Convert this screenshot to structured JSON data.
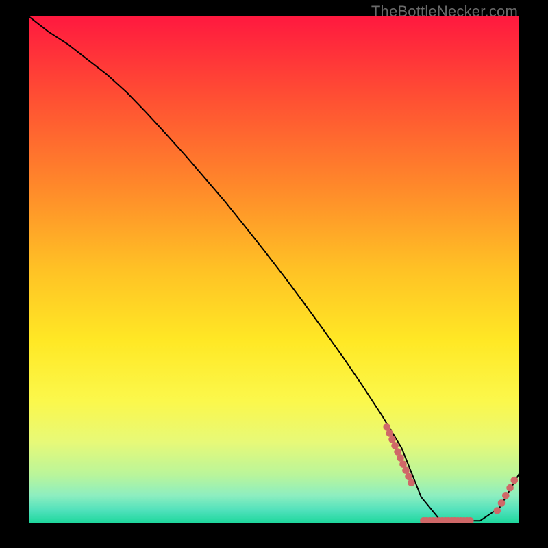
{
  "watermark": "TheBottleNecker.com",
  "chart_data": {
    "type": "line",
    "title": "",
    "xlabel": "",
    "ylabel": "",
    "xlim": [
      0,
      100
    ],
    "ylim": [
      0,
      100
    ],
    "series": [
      {
        "name": "curve",
        "x": [
          0,
          4,
          8,
          12,
          16,
          20,
          24,
          28,
          32,
          36,
          40,
          44,
          48,
          52,
          56,
          60,
          64,
          68,
          72,
          76,
          80,
          84,
          88,
          92,
          96,
          100
        ],
        "y": [
          100,
          97,
          94.5,
          91.5,
          88.5,
          85,
          81,
          76.8,
          72.5,
          68,
          63.5,
          58.7,
          53.8,
          48.8,
          43.6,
          38.3,
          32.9,
          27.2,
          21.3,
          14.9,
          5.2,
          0.5,
          0.5,
          0.5,
          3.1,
          9.8
        ]
      }
    ],
    "clusters": [
      {
        "name": "cluster-left",
        "x_range": [
          73,
          78
        ],
        "y_approx": [
          19,
          8
        ],
        "count": 10
      },
      {
        "name": "cluster-bottom",
        "x_range": [
          80.5,
          90
        ],
        "y_approx": [
          0.5,
          0.5
        ],
        "count": 16
      },
      {
        "name": "cluster-right",
        "x_range": [
          95.5,
          99
        ],
        "y_approx": [
          2.5,
          8.5
        ],
        "count": 5
      }
    ],
    "gradient_stops": [
      {
        "offset": 0.0,
        "color": "#ff193f"
      },
      {
        "offset": 0.16,
        "color": "#ff4f33"
      },
      {
        "offset": 0.34,
        "color": "#ff8a2a"
      },
      {
        "offset": 0.5,
        "color": "#ffc225"
      },
      {
        "offset": 0.64,
        "color": "#ffe825"
      },
      {
        "offset": 0.76,
        "color": "#fbf84c"
      },
      {
        "offset": 0.84,
        "color": "#e7f978"
      },
      {
        "offset": 0.905,
        "color": "#b9f59b"
      },
      {
        "offset": 0.945,
        "color": "#8deec0"
      },
      {
        "offset": 0.975,
        "color": "#4fe1bb"
      },
      {
        "offset": 1.0,
        "color": "#1cd79b"
      }
    ],
    "dot_color": "#cf6868",
    "line_color": "#000000"
  }
}
